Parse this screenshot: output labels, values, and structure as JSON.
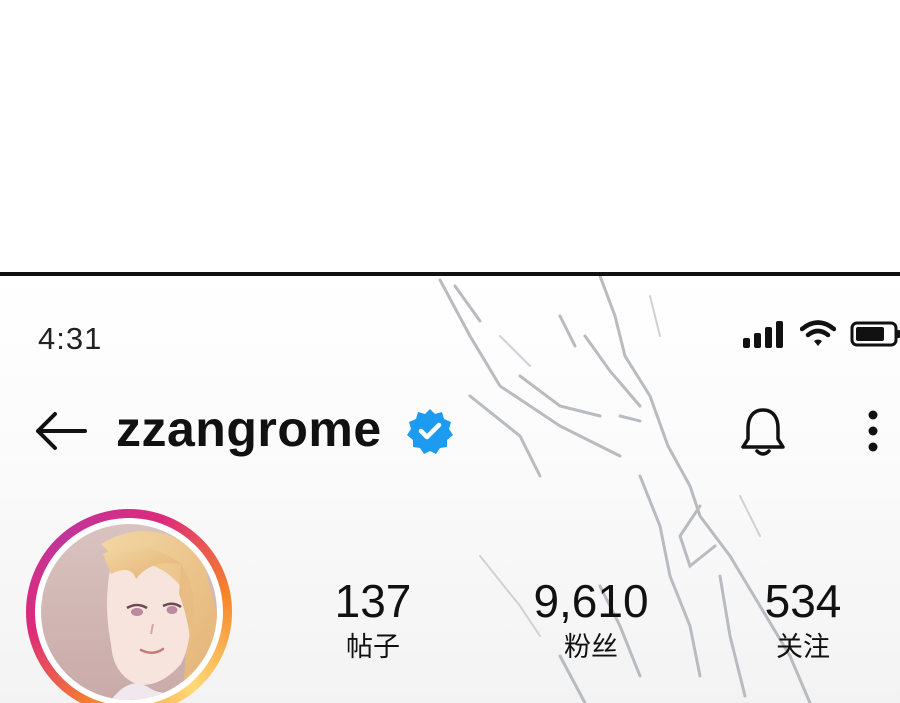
{
  "status_bar": {
    "time": "4:31",
    "icons": [
      "signal-icon",
      "wifi-icon",
      "battery-icon"
    ]
  },
  "header": {
    "back_icon": "back-arrow-icon",
    "username": "zzangrome",
    "verified_icon": "verified-badge-icon",
    "bell_icon": "bell-icon",
    "more_icon": "more-vertical-icon"
  },
  "profile": {
    "avatar_icon": "avatar",
    "stats": [
      {
        "value": "137",
        "label": "帖子"
      },
      {
        "value": "9,610",
        "label": "粉丝"
      },
      {
        "value": "534",
        "label": "关注"
      }
    ]
  },
  "colors": {
    "verified_blue": "#1d9bf0",
    "story_ring_pink": "#dd2a7b",
    "story_ring_orange": "#f58529",
    "text": "#111111",
    "panel_border": "#111111"
  }
}
